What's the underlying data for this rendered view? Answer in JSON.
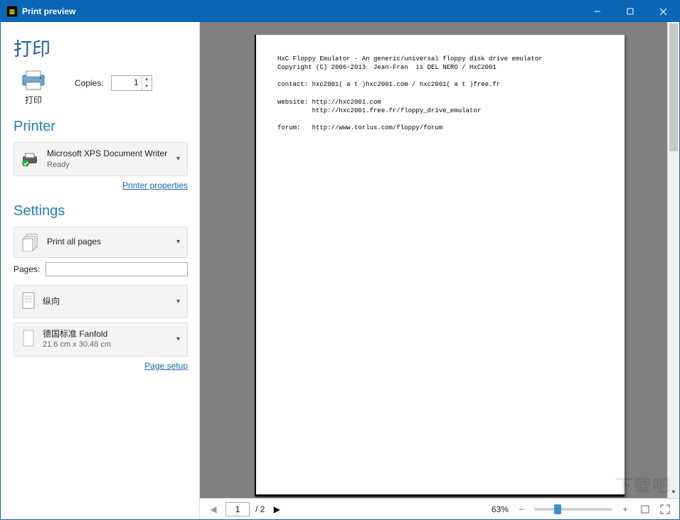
{
  "window": {
    "title": "Print preview"
  },
  "sidebar": {
    "heading_print": "打印",
    "print_button_label": "打印",
    "copies_label": "Copies:",
    "copies_value": "1",
    "heading_printer": "Printer",
    "printer": {
      "name": "Microsoft XPS Document Writer",
      "status": "Ready"
    },
    "printer_properties_link": "Printer properties",
    "heading_settings": "Settings",
    "print_range": "Print all pages",
    "pages_label": "Pages:",
    "pages_value": "",
    "orientation": "纵向",
    "paper": {
      "name": "德国标准 Fanfold",
      "size": "21.6 cm x 30.48 cm"
    },
    "page_setup_link": "Page setup"
  },
  "document": {
    "lines": [
      "HxC Floppy Emulator - An generic/universal floppy disk drive emulator",
      "Copyright (C) 2006-2013  Jean-Fran  is DEL NERO / HxC2001",
      "",
      "contact: hxc2001( a t )hxc2001.com / hxc2001( a t )free.fr",
      "",
      "website: http://hxc2001.com",
      "         http://hxc2001.free.fr/floppy_drive_emulator",
      "",
      "forum:   http://www.torlus.com/floppy/forum"
    ]
  },
  "bottombar": {
    "current_page": "1",
    "total_pages": "/ 2",
    "zoom_percent": "63%"
  }
}
